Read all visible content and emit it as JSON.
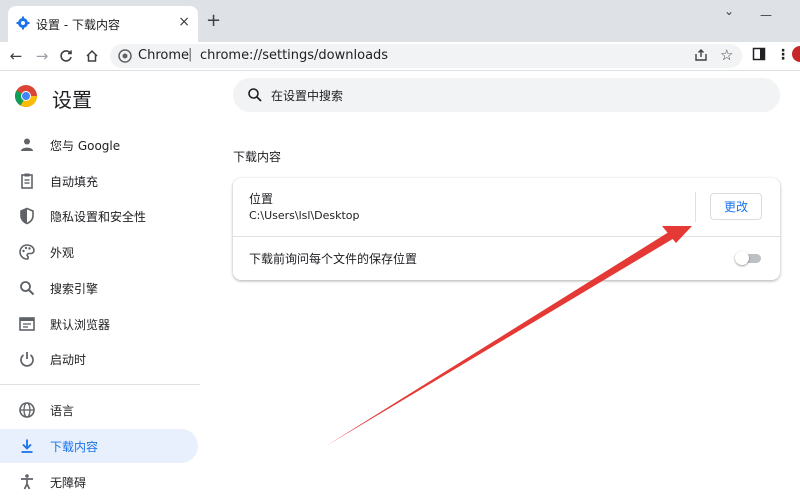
{
  "tab": {
    "title": "设置 - 下载内容",
    "close": "×",
    "new_tab": "+"
  },
  "window_controls": {
    "chevron": "⌄",
    "minimize": "—"
  },
  "omnibox": {
    "scheme_label": "Chrome",
    "separator": "|",
    "url": "chrome://settings/downloads"
  },
  "app": {
    "title": "设置"
  },
  "sidebar": {
    "items": [
      {
        "label": "您与 Google",
        "icon": "person-icon"
      },
      {
        "label": "自动填充",
        "icon": "clipboard-icon"
      },
      {
        "label": "隐私设置和安全性",
        "icon": "shield-icon"
      },
      {
        "label": "外观",
        "icon": "palette-icon"
      },
      {
        "label": "搜索引擎",
        "icon": "search-icon"
      },
      {
        "label": "默认浏览器",
        "icon": "browser-icon"
      },
      {
        "label": "启动时",
        "icon": "power-icon"
      },
      {
        "label": "语言",
        "icon": "globe-icon"
      },
      {
        "label": "下载内容",
        "icon": "download-icon",
        "active": true
      },
      {
        "label": "无障碍",
        "icon": "accessibility-icon"
      }
    ]
  },
  "search": {
    "placeholder": "在设置中搜索"
  },
  "section": {
    "title": "下载内容"
  },
  "download_card": {
    "location_label": "位置",
    "location_path": "C:\\Users\\lsl\\Desktop",
    "change_button": "更改",
    "ask_label": "下载前询问每个文件的保存位置",
    "ask_enabled": false
  },
  "colors": {
    "accent": "#1a73e8",
    "annotation_arrow": "#e53935",
    "active_nav_bg": "#e8f0fe"
  }
}
